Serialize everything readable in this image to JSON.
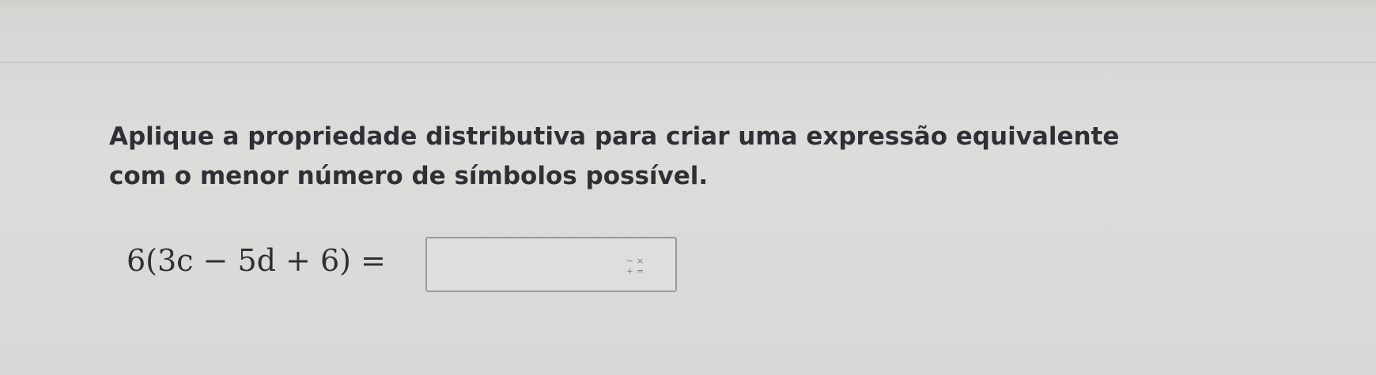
{
  "question": {
    "line1": "Aplique a propriedade distributiva para criar uma expressão equivalente",
    "line2": "com o menor número de símbolos possível."
  },
  "expression": {
    "text": "6(3c − 5d + 6) ="
  },
  "answer": {
    "value": "",
    "keypad_icon": "math-keypad-icon",
    "keypad_symbols": [
      "−",
      "×",
      "+",
      "="
    ]
  }
}
